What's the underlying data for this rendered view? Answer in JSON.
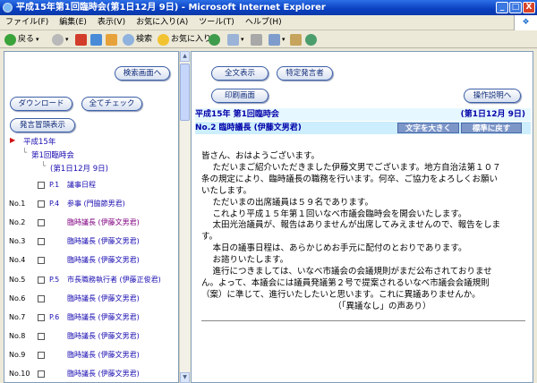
{
  "window": {
    "title": "平成15年第1回臨時会(第1日12月 9日) - Microsoft Internet Explorer",
    "min": "_",
    "max": "□",
    "close": "X"
  },
  "menu": [
    "ファイル(F)",
    "編集(E)",
    "表示(V)",
    "お気に入り(A)",
    "ツール(T)",
    "ヘルプ(H)"
  ],
  "toolbar": {
    "back": "戻る",
    "search": "検索",
    "favorites": "お気に入り"
  },
  "left": {
    "search_button": "検索画面へ",
    "download_button": "ダウンロード",
    "checkall_button": "全てチェック",
    "speaker_button": "発言冒頭表示",
    "tree_year": "平成15年",
    "tree_session": "第1回臨時会",
    "tree_day": "(第1日12月 9日)",
    "rows": [
      {
        "no": "",
        "page": "P.1",
        "text": "議事日程",
        "purple": false
      },
      {
        "no": "No.1",
        "page": "P.4",
        "text": "参事 (門脇節男君)",
        "purple": false
      },
      {
        "no": "No.2",
        "page": "",
        "text": "臨時議長 (伊藤文男君)",
        "purple": true
      },
      {
        "no": "No.3",
        "page": "",
        "text": "臨時議長 (伊藤文男君)",
        "purple": false
      },
      {
        "no": "No.4",
        "page": "",
        "text": "臨時議長 (伊藤文男君)",
        "purple": false
      },
      {
        "no": "No.5",
        "page": "P.5",
        "text": "市長職務執行者 (伊藤正俊君)",
        "purple": false
      },
      {
        "no": "No.6",
        "page": "",
        "text": "臨時議長 (伊藤文男君)",
        "purple": false
      },
      {
        "no": "No.7",
        "page": "P.6",
        "text": "臨時議長 (伊藤文男君)",
        "purple": false
      },
      {
        "no": "No.8",
        "page": "",
        "text": "臨時議長 (伊藤文男君)",
        "purple": false
      },
      {
        "no": "No.9",
        "page": "",
        "text": "臨時議長 (伊藤文男君)",
        "purple": false
      },
      {
        "no": "No.10",
        "page": "",
        "text": "臨時議長 (伊藤文男君)",
        "purple": false
      }
    ]
  },
  "right": {
    "fulltext_button": "全文表示",
    "speaker_button": "特定発言者",
    "print_button": "印刷画面",
    "manual_button": "操作説明へ",
    "session_title": "平成15年 第1回臨時会",
    "session_day": "(第1日12月 9日)",
    "speaker_line": "No.2 臨時議長 (伊藤文男君)",
    "enlarge_button": "文字を大きく",
    "reset_button": "標準に戻す",
    "speech": "皆さん、おはようございます。\n 　ただいまご紹介いただきました伊藤文男でございます。地方自治法第１０７\n条の規定により、臨時議長の職務を行います。何卒、ご協力をよろしくお願い\nいたします。\n 　ただいまの出席議員は５９名であります。\n 　これより平成１５年第１回いなべ市議会臨時会を開会いたします。\n 　太田光治議員が、報告はありませんが出席してみえませんので、報告をしま\nす。\n 　本日の議事日程は、あらかじめお手元に配付のとおりであります。\n 　お諮りいたします。\n 　進行につきましては、いなべ市議会の会議規則がまだ公布されておりませ\nん。よって、本議会には議員発議第２号で提案されるいなべ市議会会議規則\n（案）に準じて、進行いたしたいと思います。これに異議ありませんか。\n　　　　　　　　　　　　　　　　（「異議なし」の声あり）"
  }
}
